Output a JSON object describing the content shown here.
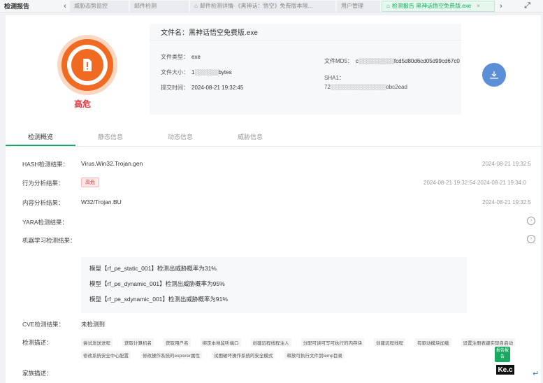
{
  "header": {
    "app_title": "检测报告",
    "tabs": [
      {
        "label": "威胁态势监控",
        "active": false
      },
      {
        "label": "邮件检测",
        "active": false
      },
      {
        "label": "邮件检测详情-《黑神话：悟空》免费版本限...",
        "active": false
      },
      {
        "label": "用户管理",
        "active": false
      },
      {
        "label": "检测报告 黑神话悟空免费版.exe",
        "active": true
      }
    ],
    "close_glyph": "×"
  },
  "file": {
    "risk_level": "高危",
    "name_label": "文件名：",
    "name": "黑神话悟空免费版.exe",
    "type_label": "文件类型：",
    "type": "exe",
    "size_label": "文件大小：",
    "size": "1░░░░░░bytes",
    "submit_time_label": "提交时间：",
    "submit_time": "2024-08-21 19:32:45",
    "md5_label": "文件MD5：",
    "md5": "c░░░░░░░░░fcd5d80d6cd05d99cd67c0",
    "sha1_label": "SHA1：",
    "sha1": "72░░░░░░░░░░░░░░obc2ead"
  },
  "detail_tabs": [
    "检测概览",
    "静态信息",
    "动态信息",
    "威胁信息"
  ],
  "results": {
    "hash_label": "HASH检测结果：",
    "hash_value": "Virus.Win32.Trojan.gen",
    "hash_time": "2024-08-21 19:32:5",
    "behavior_label": "行为分析结果：",
    "behavior_badge": "高危",
    "behavior_time": "2024-08-21 19:32:54-2024-08-21 19:34:0",
    "content_label": "内容分析结果：",
    "content_value": "W32/Trojan.BU",
    "content_time": "2024-08-21 19:32:5",
    "yara_label": "YARA检测结果：",
    "ml_label": "机器学习检测结果：",
    "ml_lines": [
      "模型【rf_pe_static_001】检测出威胁概率为31%",
      "模型【rf_pe_dynamic_001】检测出威胁概率为95%",
      "模型【rf_pe_sdynamic_001】检测出威胁概率为91%"
    ],
    "cve_label": "CVE检测结果：",
    "cve_value": "未检测到",
    "behavior_desc_label": "检测描述：",
    "behavior_tags": [
      "尝试发送进程",
      "获取计算机名",
      "获取用户名",
      "绑定本地监听端口",
      "创建远程线程注入",
      "分配可读可写可执行的内存块",
      "创建远程线程",
      "有驱动模块加载",
      "设置注册表键实现自启动",
      "修改系统安全中心配置",
      "修改操作系统的explorer属性",
      "试图破坏操作系统的安全模式",
      "释放可执行文件到temp目录"
    ],
    "family_label": "家族描述："
  },
  "floating": {
    "report_btn": "报告报告",
    "corner_logo": "Ke.c",
    "corner_arrow": "↵"
  },
  "colors": {
    "accent": "#1aa760",
    "risk": "#f06a21",
    "danger": "#e0383e",
    "download": "#5b8fd8"
  }
}
